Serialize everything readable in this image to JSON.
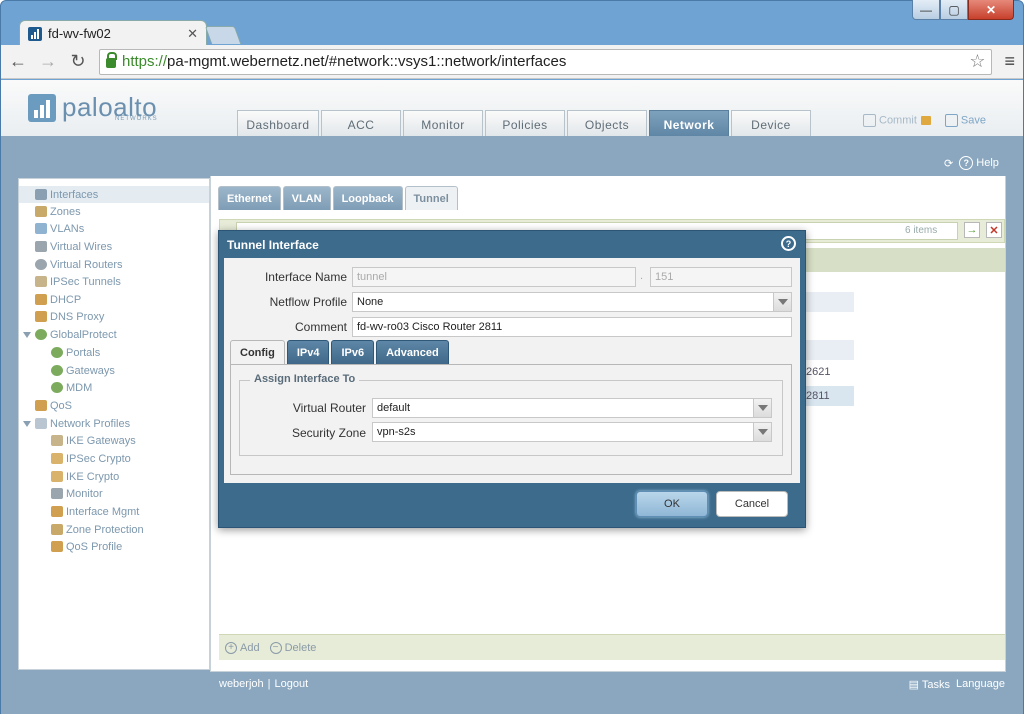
{
  "browser": {
    "tab_title": "fd-wv-fw02",
    "url_scheme": "https://",
    "url_rest": "pa-mgmt.webernetz.net/#network::vsys1::network/interfaces"
  },
  "app": {
    "logo_text": "paloalto",
    "logo_sub": "NETWORKS",
    "main_tabs": [
      "Dashboard",
      "ACC",
      "Monitor",
      "Policies",
      "Objects",
      "Network",
      "Device"
    ],
    "active_tab": "Network",
    "commit_label": "Commit",
    "save_label": "Save",
    "help_label": "Help"
  },
  "sidebar": {
    "items": [
      {
        "label": "Interfaces",
        "icon": "interfaces-icon",
        "selected": true
      },
      {
        "label": "Zones",
        "icon": "zones-icon"
      },
      {
        "label": "VLANs",
        "icon": "vlans-icon"
      },
      {
        "label": "Virtual Wires",
        "icon": "virtual-wires-icon"
      },
      {
        "label": "Virtual Routers",
        "icon": "virtual-routers-icon"
      },
      {
        "label": "IPSec Tunnels",
        "icon": "ipsec-tunnels-icon"
      },
      {
        "label": "DHCP",
        "icon": "dhcp-icon"
      },
      {
        "label": "DNS Proxy",
        "icon": "dns-proxy-icon"
      },
      {
        "label": "GlobalProtect",
        "icon": "globalprotect-icon"
      },
      {
        "label": "Portals",
        "icon": "portals-icon"
      },
      {
        "label": "Gateways",
        "icon": "gateways-icon"
      },
      {
        "label": "MDM",
        "icon": "mdm-icon"
      },
      {
        "label": "QoS",
        "icon": "qos-icon"
      },
      {
        "label": "Network Profiles",
        "icon": "network-profiles-icon"
      },
      {
        "label": "IKE Gateways",
        "icon": "ike-gateways-icon"
      },
      {
        "label": "IPSec Crypto",
        "icon": "ipsec-crypto-icon"
      },
      {
        "label": "IKE Crypto",
        "icon": "ike-crypto-icon"
      },
      {
        "label": "Monitor",
        "icon": "monitor-icon"
      },
      {
        "label": "Interface Mgmt",
        "icon": "interface-mgmt-icon"
      },
      {
        "label": "Zone Protection",
        "icon": "zone-protection-icon"
      },
      {
        "label": "QoS Profile",
        "icon": "qos-profile-icon"
      }
    ]
  },
  "subtabs": [
    "Ethernet",
    "VLAN",
    "Loopback",
    "Tunnel"
  ],
  "active_subtab": "Tunnel",
  "grid": {
    "item_count": "6 items",
    "visible_cells": [
      "2621",
      "2811"
    ],
    "add_label": "Add",
    "delete_label": "Delete"
  },
  "footer": {
    "user": "weberjoh",
    "logout": "Logout",
    "tasks": "Tasks",
    "language": "Language"
  },
  "dialog": {
    "title": "Tunnel Interface",
    "interface_name_label": "Interface Name",
    "interface_name_value": "tunnel",
    "interface_separator": ".",
    "interface_number": "151",
    "netflow_label": "Netflow Profile",
    "netflow_value": "None",
    "comment_label": "Comment",
    "comment_value": "fd-wv-ro03 Cisco Router 2811",
    "tabs": [
      "Config",
      "IPv4",
      "IPv6",
      "Advanced"
    ],
    "active_tab": "Config",
    "section_title": "Assign Interface To",
    "virtual_router_label": "Virtual Router",
    "virtual_router_value": "default",
    "security_zone_label": "Security Zone",
    "security_zone_value": "vpn-s2s",
    "ok_label": "OK",
    "cancel_label": "Cancel"
  }
}
